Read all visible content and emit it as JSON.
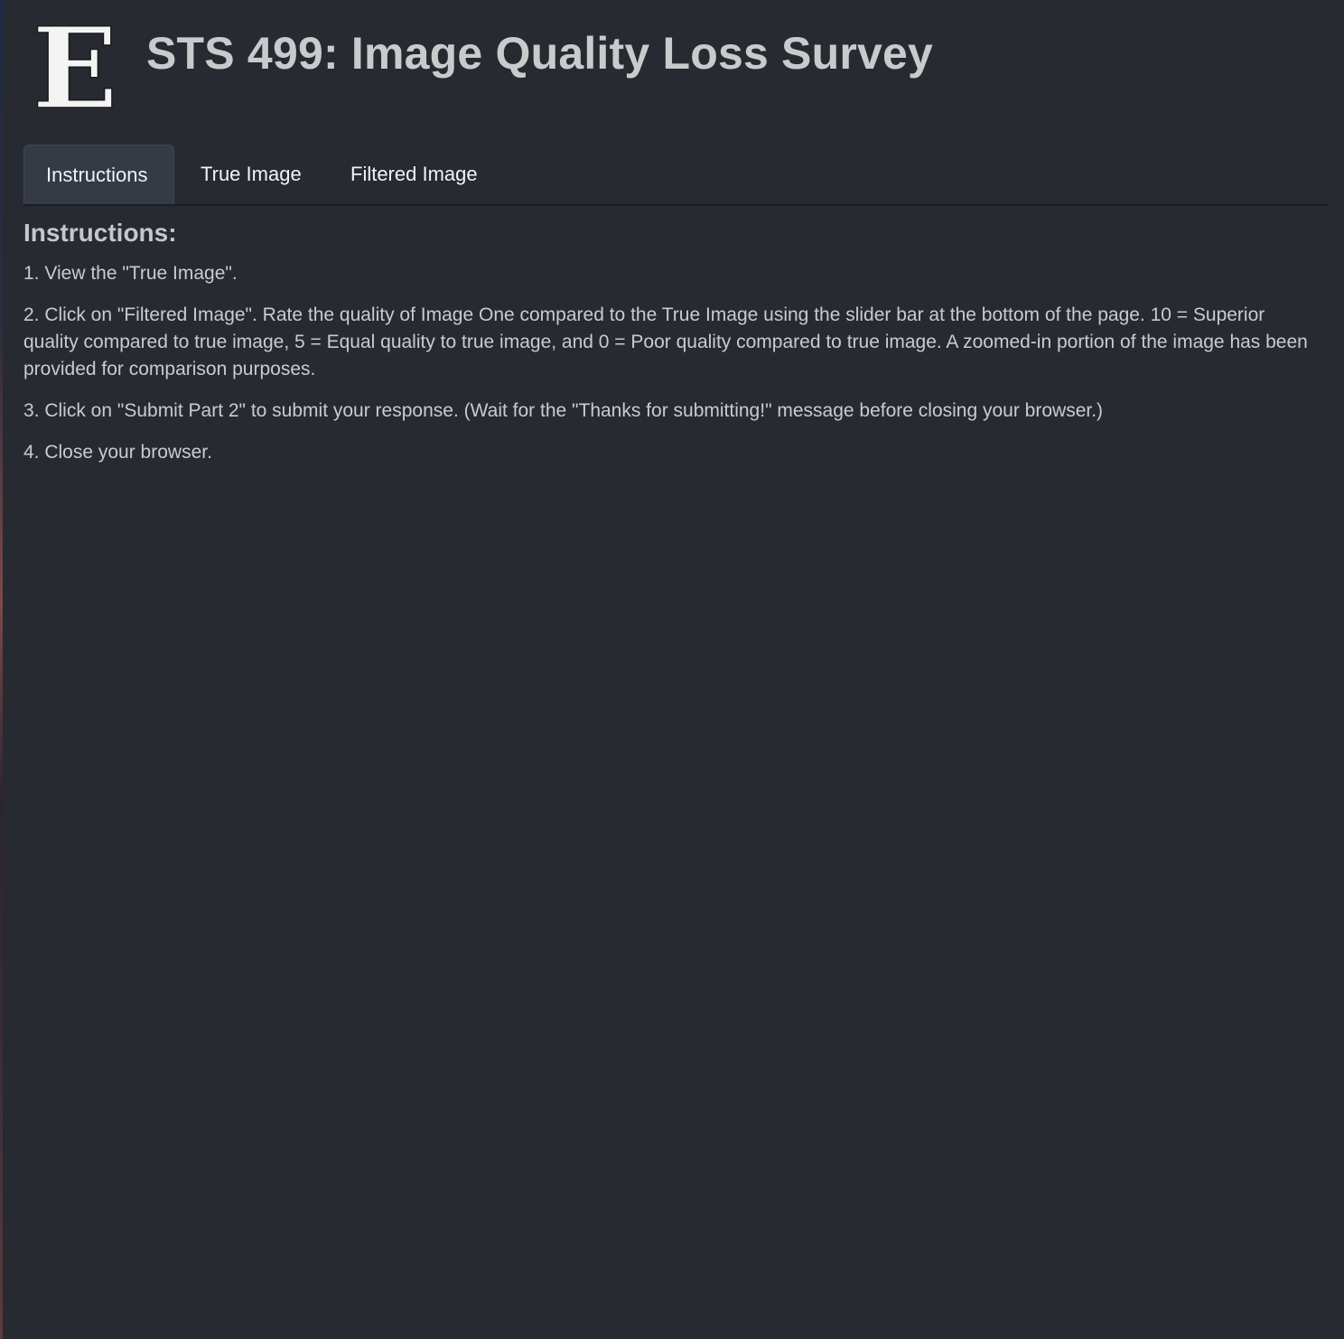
{
  "header": {
    "logo_letter": "E",
    "title": "STS 499: Image Quality Loss Survey"
  },
  "tabs": [
    {
      "label": "Instructions",
      "active": true
    },
    {
      "label": "True Image",
      "active": false
    },
    {
      "label": "Filtered Image",
      "active": false
    }
  ],
  "instructions": {
    "heading": "Instructions:",
    "steps": [
      "1. View the \"True Image\".",
      "2. Click on \"Filtered Image\". Rate the quality of Image One compared to the True Image using the slider bar at the bottom of the page. 10 = Superior quality compared to true image, 5 = Equal quality to true image, and 0 = Poor quality compared to true image. A zoomed-in portion of the image has been provided for comparison purposes.",
      "3. Click on \"Submit Part 2\" to submit your response. (Wait for the \"Thanks for submitting!\" message before closing your browser.)",
      "4. Close your browser."
    ]
  },
  "colors": {
    "background": "#272a30",
    "active_tab": "#353b44",
    "text": "#c9cbcf",
    "tab_text": "#f2f3f5"
  }
}
